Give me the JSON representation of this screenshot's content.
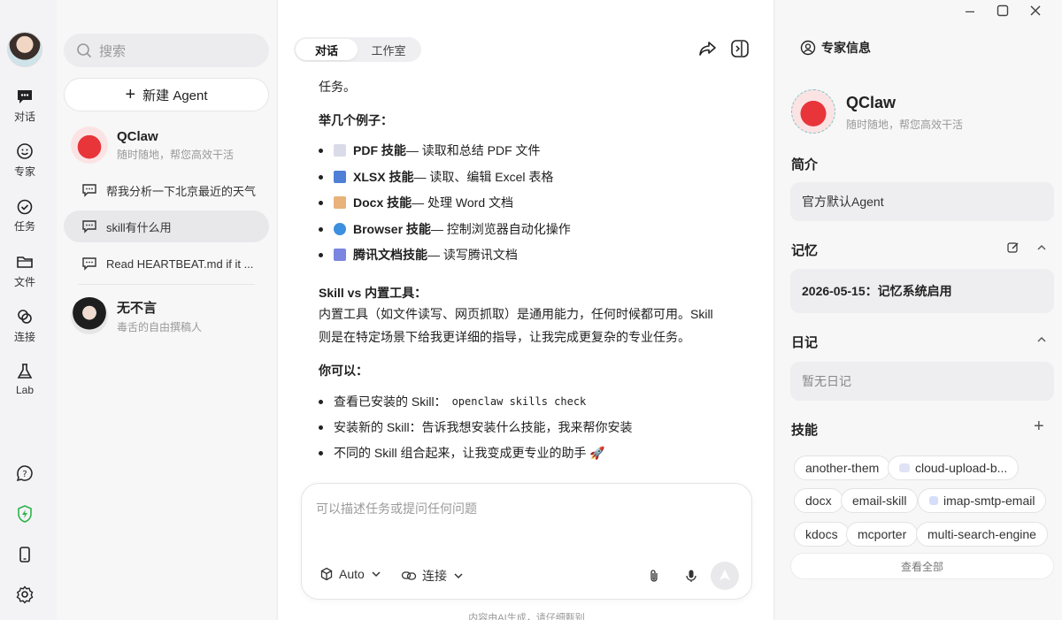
{
  "rail": {
    "nav": [
      {
        "label": "对话",
        "icon": "chat-bubble-icon"
      },
      {
        "label": "专家",
        "icon": "smiley-sparkle-icon"
      },
      {
        "label": "任务",
        "icon": "clock-check-icon"
      },
      {
        "label": "文件",
        "icon": "folder-icon"
      },
      {
        "label": "连接",
        "icon": "link-icon"
      },
      {
        "label": "Lab",
        "icon": "flask-icon"
      }
    ],
    "bottom_icons": [
      "help-icon",
      "shield-bolt-icon",
      "phone-icon",
      "settings-icon"
    ]
  },
  "sidebar": {
    "search_placeholder": "搜索",
    "new_agent_label": "新建 Agent",
    "agents": [
      {
        "name": "QClaw",
        "subtitle": "随时随地，帮您高效干活"
      },
      {
        "name": "无不言",
        "subtitle": "毒舌的自由撰稿人"
      }
    ],
    "chats": [
      {
        "title": "帮我分析一下北京最近的天气"
      },
      {
        "title": "skill有什么用"
      },
      {
        "title": "Read HEARTBEAT.md if it ..."
      }
    ]
  },
  "main": {
    "tabs": [
      {
        "label": "对话"
      },
      {
        "label": "工作室"
      }
    ],
    "content": {
      "intro_tail": "任务。",
      "examples_heading": "举几个例子：",
      "skills": [
        {
          "name": "PDF 技能",
          "desc": " — 读取和总结 PDF 文件",
          "color": "#d9dbe8"
        },
        {
          "name": "XLSX 技能",
          "desc": " — 读取、编辑 Excel 表格",
          "color": "#4f7fd6"
        },
        {
          "name": "Docx 技能",
          "desc": " — 处理 Word 文档",
          "color": "#e9b27a"
        },
        {
          "name": "Browser 技能",
          "desc": " — 控制浏览器自动化操作",
          "color": "#3d8fe0"
        },
        {
          "name": "腾讯文档技能",
          "desc": " — 读写腾讯文档",
          "color": "#7a86e0"
        }
      ],
      "vs_heading": "Skill vs 内置工具：",
      "vs_line1": "内置工具（如文件读写、网页抓取）是通用能力，任何时候都可用。Skill",
      "vs_line2": "则是在特定场景下给我更详细的指导，让我完成更复杂的专业任务。",
      "can_heading": "你可以：",
      "can1_text": "查看已安装的 Skill：",
      "can1_code": "openclaw skills check",
      "can2": "安装新的 Skill：告诉我想安装什么技能，我来帮你安装",
      "can3": "不同的 Skill 组合起来，让我变成更专业的助手 🚀"
    },
    "input": {
      "placeholder": "可以描述任务或提问任何问题",
      "model_label": "Auto",
      "connect_label": "连接"
    },
    "footer": "内容由AI生成，请仔细甄别"
  },
  "right": {
    "title": "专家信息",
    "profile": {
      "name": "QClaw",
      "subtitle": "随时随地，帮您高效干活"
    },
    "intro_title": "简介",
    "intro_text": "官方默认Agent",
    "memory_title": "记忆",
    "memory_text": "2026-05-15：记忆系统启用",
    "diary_title": "日记",
    "diary_text": "暂无日记",
    "skills_title": "技能",
    "skills": [
      {
        "label": "another-them"
      },
      {
        "label": "cloud-upload-b..."
      },
      {
        "label": "docx"
      },
      {
        "label": "email-skill"
      },
      {
        "label": "imap-smtp-email"
      },
      {
        "label": "kdocs"
      },
      {
        "label": "mcporter"
      },
      {
        "label": "multi-search-engine"
      }
    ],
    "view_all": "查看全部"
  },
  "colors": {
    "accent_green": "#2db34a",
    "qclaw_red": "#e8353a"
  }
}
